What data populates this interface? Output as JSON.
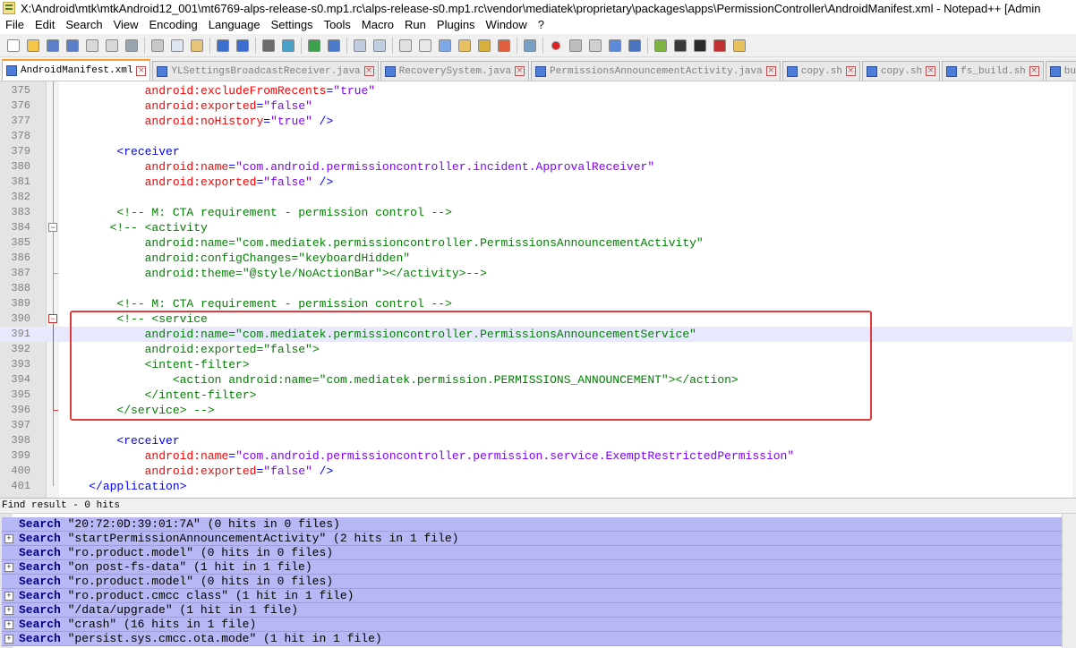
{
  "window": {
    "title": "X:\\Android\\mtk\\mtkAndroid12_001\\mt6769-alps-release-s0.mp1.rc\\alps-release-s0.mp1.rc\\vendor\\mediatek\\proprietary\\packages\\apps\\PermissionController\\AndroidManifest.xml - Notepad++ [Admin"
  },
  "menu": [
    "File",
    "Edit",
    "Search",
    "View",
    "Encoding",
    "Language",
    "Settings",
    "Tools",
    "Macro",
    "Run",
    "Plugins",
    "Window",
    "?"
  ],
  "toolbar_icons": [
    "new-file-icon",
    "open-file-icon",
    "save-icon",
    "save-all-icon",
    "close-icon",
    "close-all-icon",
    "print-icon",
    "cut-icon",
    "copy-icon",
    "paste-icon",
    "undo-icon",
    "redo-icon",
    "find-icon",
    "replace-icon",
    "zoom-in-icon",
    "zoom-out-icon",
    "sync-vertical-icon",
    "sync-horizontal-icon",
    "word-wrap-icon",
    "show-all-chars-icon",
    "indent-guide-icon",
    "doc-map-icon",
    "function-list-icon",
    "folder-as-workspace-icon",
    "monitoring-icon",
    "record-macro-icon",
    "stop-record-icon",
    "play-macro-icon",
    "run-multiple-icon",
    "save-macro-icon",
    "android-icon",
    "phone-icon",
    "console-icon",
    "spellcheck-icon",
    "plugin-folder-icon"
  ],
  "tabs": [
    {
      "label": "AndroidManifest.xml",
      "active": true
    },
    {
      "label": "YLSettingsBroadcastReceiver.java",
      "active": false
    },
    {
      "label": "RecoverySystem.java",
      "active": false
    },
    {
      "label": "PermissionsAnnouncementActivity.java",
      "active": false
    },
    {
      "label": "copy.sh",
      "active": false
    },
    {
      "label": "copy.sh",
      "active": false
    },
    {
      "label": "fs_build.sh",
      "active": false
    },
    {
      "label": "buildinfo.sh",
      "active": false
    }
  ],
  "editor": {
    "current_line": 391,
    "lines": [
      {
        "n": "375",
        "parts": [
          [
            "",
            "            "
          ],
          [
            "attr",
            "android:excludeFromRecents"
          ],
          [
            "tag",
            "="
          ],
          [
            "str",
            "\"true\""
          ]
        ]
      },
      {
        "n": "376",
        "parts": [
          [
            "",
            "            "
          ],
          [
            "attr",
            "android:exported"
          ],
          [
            "tag",
            "="
          ],
          [
            "str",
            "\"false\""
          ]
        ]
      },
      {
        "n": "377",
        "parts": [
          [
            "",
            "            "
          ],
          [
            "attr",
            "android:noHistory"
          ],
          [
            "tag",
            "="
          ],
          [
            "str",
            "\"true\""
          ],
          [
            "tag",
            " />"
          ]
        ]
      },
      {
        "n": "378",
        "parts": []
      },
      {
        "n": "379",
        "parts": [
          [
            "",
            "        "
          ],
          [
            "tag",
            "<receiver"
          ]
        ]
      },
      {
        "n": "380",
        "parts": [
          [
            "",
            "            "
          ],
          [
            "attr",
            "android:name"
          ],
          [
            "tag",
            "="
          ],
          [
            "str",
            "\"com.android.permissioncontroller.incident.ApprovalReceiver\""
          ]
        ]
      },
      {
        "n": "381",
        "parts": [
          [
            "",
            "            "
          ],
          [
            "attr",
            "android:exported"
          ],
          [
            "tag",
            "="
          ],
          [
            "str",
            "\"false\""
          ],
          [
            "tag",
            " />"
          ]
        ]
      },
      {
        "n": "382",
        "parts": []
      },
      {
        "n": "383",
        "parts": [
          [
            "",
            "        "
          ],
          [
            "com",
            "<!-- M: CTA requirement - permission control -->"
          ]
        ]
      },
      {
        "n": "384",
        "parts": [
          [
            "",
            "       "
          ],
          [
            "com",
            "<!-- <activity"
          ]
        ]
      },
      {
        "n": "385",
        "parts": [
          [
            "",
            "            "
          ],
          [
            "com",
            "android:name=\"com.mediatek.permissioncontroller.PermissionsAnnouncementActivity\""
          ]
        ]
      },
      {
        "n": "386",
        "parts": [
          [
            "",
            "            "
          ],
          [
            "com",
            "android:configChanges=\"keyboardHidden\""
          ]
        ]
      },
      {
        "n": "387",
        "parts": [
          [
            "",
            "            "
          ],
          [
            "com",
            "android:theme=\"@style/NoActionBar\"></activity>-->"
          ]
        ]
      },
      {
        "n": "388",
        "parts": []
      },
      {
        "n": "389",
        "parts": [
          [
            "",
            "        "
          ],
          [
            "com",
            "<!-- M: CTA requirement - permission control -->"
          ]
        ]
      },
      {
        "n": "390",
        "parts": [
          [
            "",
            "        "
          ],
          [
            "com",
            "<!-- <service"
          ]
        ]
      },
      {
        "n": "391",
        "parts": [
          [
            "",
            "            "
          ],
          [
            "com",
            "android:name=\"com.mediatek.permissioncontroller.PermissionsAnnouncementService\""
          ]
        ]
      },
      {
        "n": "392",
        "parts": [
          [
            "",
            "            "
          ],
          [
            "com",
            "android:exported=\"false\">"
          ]
        ]
      },
      {
        "n": "393",
        "parts": [
          [
            "",
            "            "
          ],
          [
            "com",
            "<intent-filter>"
          ]
        ]
      },
      {
        "n": "394",
        "parts": [
          [
            "",
            "                "
          ],
          [
            "com",
            "<action android:name=\"com.mediatek.permission.PERMISSIONS_ANNOUNCEMENT\"></action>"
          ]
        ]
      },
      {
        "n": "395",
        "parts": [
          [
            "",
            "            "
          ],
          [
            "com",
            "</intent-filter>"
          ]
        ]
      },
      {
        "n": "396",
        "parts": [
          [
            "",
            "        "
          ],
          [
            "com",
            "</service> -->"
          ]
        ]
      },
      {
        "n": "397",
        "parts": []
      },
      {
        "n": "398",
        "parts": [
          [
            "",
            "        "
          ],
          [
            "tag",
            "<receiver"
          ]
        ]
      },
      {
        "n": "399",
        "parts": [
          [
            "",
            "            "
          ],
          [
            "attr",
            "android:name"
          ],
          [
            "tag",
            "="
          ],
          [
            "str",
            "\"com.android.permissioncontroller.permission.service.ExemptRestrictedPermission\""
          ]
        ]
      },
      {
        "n": "400",
        "parts": [
          [
            "",
            "            "
          ],
          [
            "attr",
            "android:exported"
          ],
          [
            "tag",
            "="
          ],
          [
            "str",
            "\"false\""
          ],
          [
            "tag",
            " />"
          ]
        ]
      },
      {
        "n": "401",
        "parts": [
          [
            "",
            "    "
          ],
          [
            "tag",
            "</application>"
          ]
        ]
      }
    ]
  },
  "find_result": {
    "header": "Find result - 0 hits",
    "rows": [
      {
        "expand": false,
        "keyword": "Search",
        "text": " \"20:72:0D:39:01:7A\" (0 hits in 0 files)"
      },
      {
        "expand": true,
        "keyword": "Search",
        "text": " \"startPermissionAnnouncementActivity\" (2 hits in 1 file)"
      },
      {
        "expand": false,
        "keyword": "Search",
        "text": " \"ro.product.model\" (0 hits in 0 files)"
      },
      {
        "expand": true,
        "keyword": "Search",
        "text": " \"on post-fs-data\" (1 hit in 1 file)"
      },
      {
        "expand": false,
        "keyword": "Search",
        "text": " \"ro.product.model\" (0 hits in 0 files)"
      },
      {
        "expand": true,
        "keyword": "Search",
        "text": " \"ro.product.cmcc class\" (1 hit in 1 file)"
      },
      {
        "expand": true,
        "keyword": "Search",
        "text": " \"/data/upgrade\" (1 hit in 1 file)"
      },
      {
        "expand": true,
        "keyword": "Search",
        "text": " \"crash\" (16 hits in 1 file)"
      },
      {
        "expand": true,
        "keyword": "Search",
        "text": " \"persist.sys.cmcc.ota.mode\" (1 hit in 1 file)"
      }
    ]
  },
  "colors": {
    "tag": "#0000ff",
    "attr": "#ff0000",
    "string": "#8000ff",
    "comment": "#008000",
    "find_row_bg": "#b7b7f5",
    "annotation_box": "#e23b3b"
  }
}
